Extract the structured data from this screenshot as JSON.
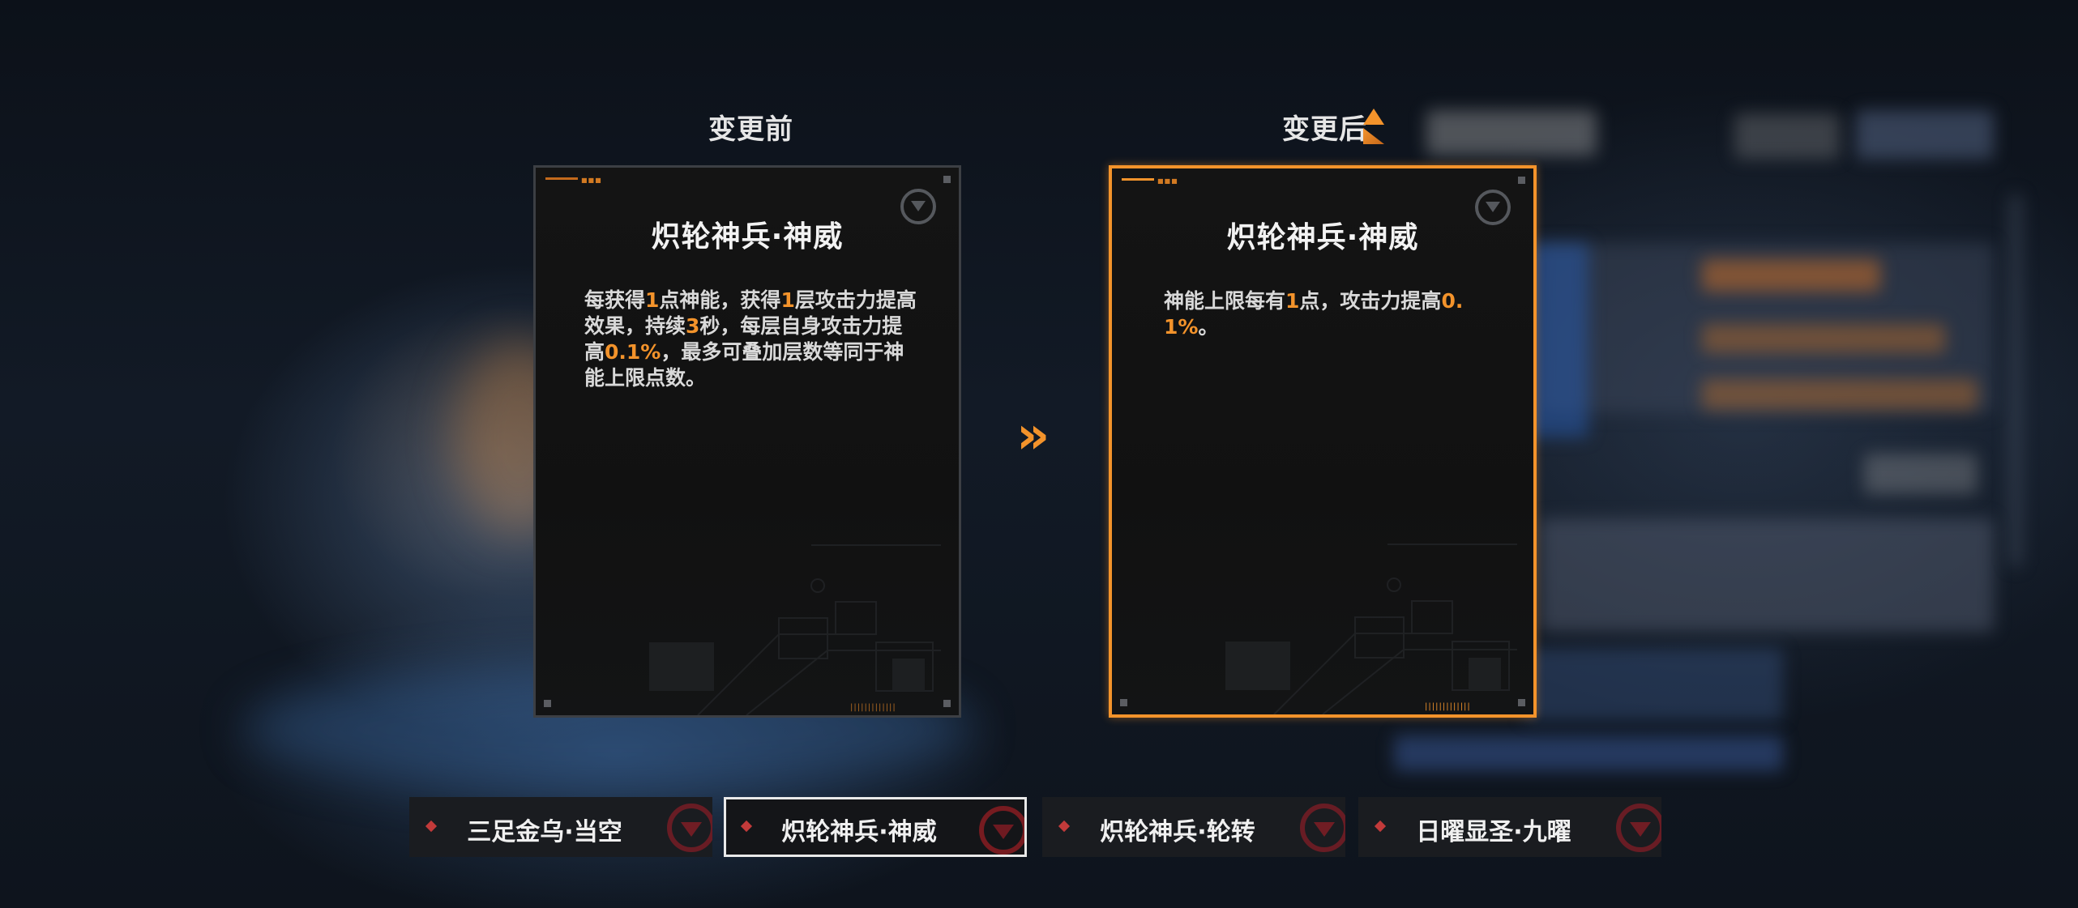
{
  "before": {
    "heading": "变更前",
    "card": {
      "name": "炽轮神兵·神威",
      "desc_parts": [
        "每获得",
        "1",
        "点神能，获得",
        "1",
        "层攻击力提高效果，持续",
        "3",
        "秒，每层自身攻击力提高",
        "0.1%",
        "，最多可叠加层数等同于神能上限点数。"
      ]
    }
  },
  "after": {
    "heading": "变更后",
    "card": {
      "name": "炽轮神兵·神威",
      "desc_parts": [
        "神能上限每有",
        "1",
        "点，攻击力提高",
        "0.1%",
        "。"
      ]
    }
  },
  "colors": {
    "accent": "#f3932b",
    "text": "#f2f2f2",
    "card_border": "#3c3f44",
    "tab_diamond": "#c23a3a"
  },
  "icons": {
    "transition_arrow": "double-chevron-right",
    "change_indicator": "up-arrow",
    "emblem": "circle-triangle-emblem"
  },
  "tabs": [
    {
      "label": "三足金乌·当空",
      "active": false
    },
    {
      "label": "炽轮神兵·神威",
      "active": true
    },
    {
      "label": "炽轮神兵·轮转",
      "active": false
    },
    {
      "label": "日曜显圣·九曜",
      "active": false
    }
  ]
}
